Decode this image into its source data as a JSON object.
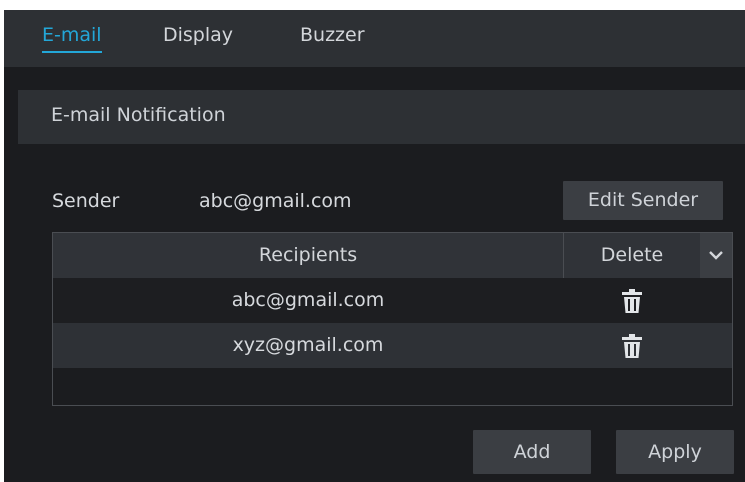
{
  "tabs": [
    {
      "label": "E-mail",
      "active": true
    },
    {
      "label": "Display",
      "active": false
    },
    {
      "label": "Buzzer",
      "active": false
    }
  ],
  "section": {
    "title": "E-mail Notification"
  },
  "sender": {
    "label": "Sender",
    "value": "abc@gmail.com",
    "edit_label": "Edit Sender"
  },
  "table": {
    "headers": {
      "recipients": "Recipients",
      "delete": "Delete"
    },
    "rows": [
      {
        "email": "abc@gmail.com",
        "delete_icon": "trash-icon"
      },
      {
        "email": "xyz@gmail.com",
        "delete_icon": "trash-icon"
      }
    ]
  },
  "actions": {
    "add_label": "Add",
    "apply_label": "Apply"
  },
  "colors": {
    "accent": "#23a7d8",
    "background": "#1b1c1f",
    "panel": "#2d3034",
    "button": "#3b3e43"
  }
}
